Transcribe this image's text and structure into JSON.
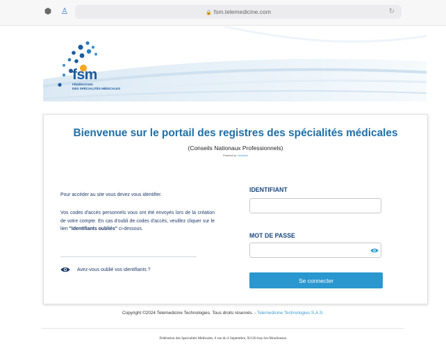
{
  "browser": {
    "url": "fsm.telemedicine.com"
  },
  "header": {
    "logo_text": "fsm",
    "logo_sub_line1": "FÉDÉRATION",
    "logo_sub_line2": "DES SPÉCIALITÉS MÉDICALES"
  },
  "main": {
    "title": "Bienvenue sur le portail des registres des spécialités médicales",
    "subtitle": "(Conseils Nationaux Professionnels)",
    "powered_prefix": "Powered by",
    "powered_link": "Libertable"
  },
  "info": {
    "line1": "Pour accéder au site vous devez vous identifier.",
    "paragraph_prefix": "Vos codes d'accès personnels vous ont été envoyés lors de la création de votre compte. En cas d'oubli de codes d'accès, veuillez cliquer sur le lien",
    "paragraph_link": "\"Identifiants oubliés\"",
    "paragraph_suffix": " ci-dessous.",
    "forgot_link": "Avez-vous oublié vos identifiants ?"
  },
  "form": {
    "identifiant_label": "IDENTIFIANT",
    "identifiant_value": "",
    "password_label": "MOT DE PASSE",
    "password_value": "",
    "submit_label": "Se connecter"
  },
  "copyright": {
    "text": "Copyright ©2024 Telemedicine Technologies. Tous droits réservés. -",
    "link": "Telemedicine Technologies S.A.S."
  },
  "footer": {
    "address": "Fédération des Spécialités Médicales, 6 rue du 4 Septembre, 92130 Issy-les-Moulineaux"
  }
}
